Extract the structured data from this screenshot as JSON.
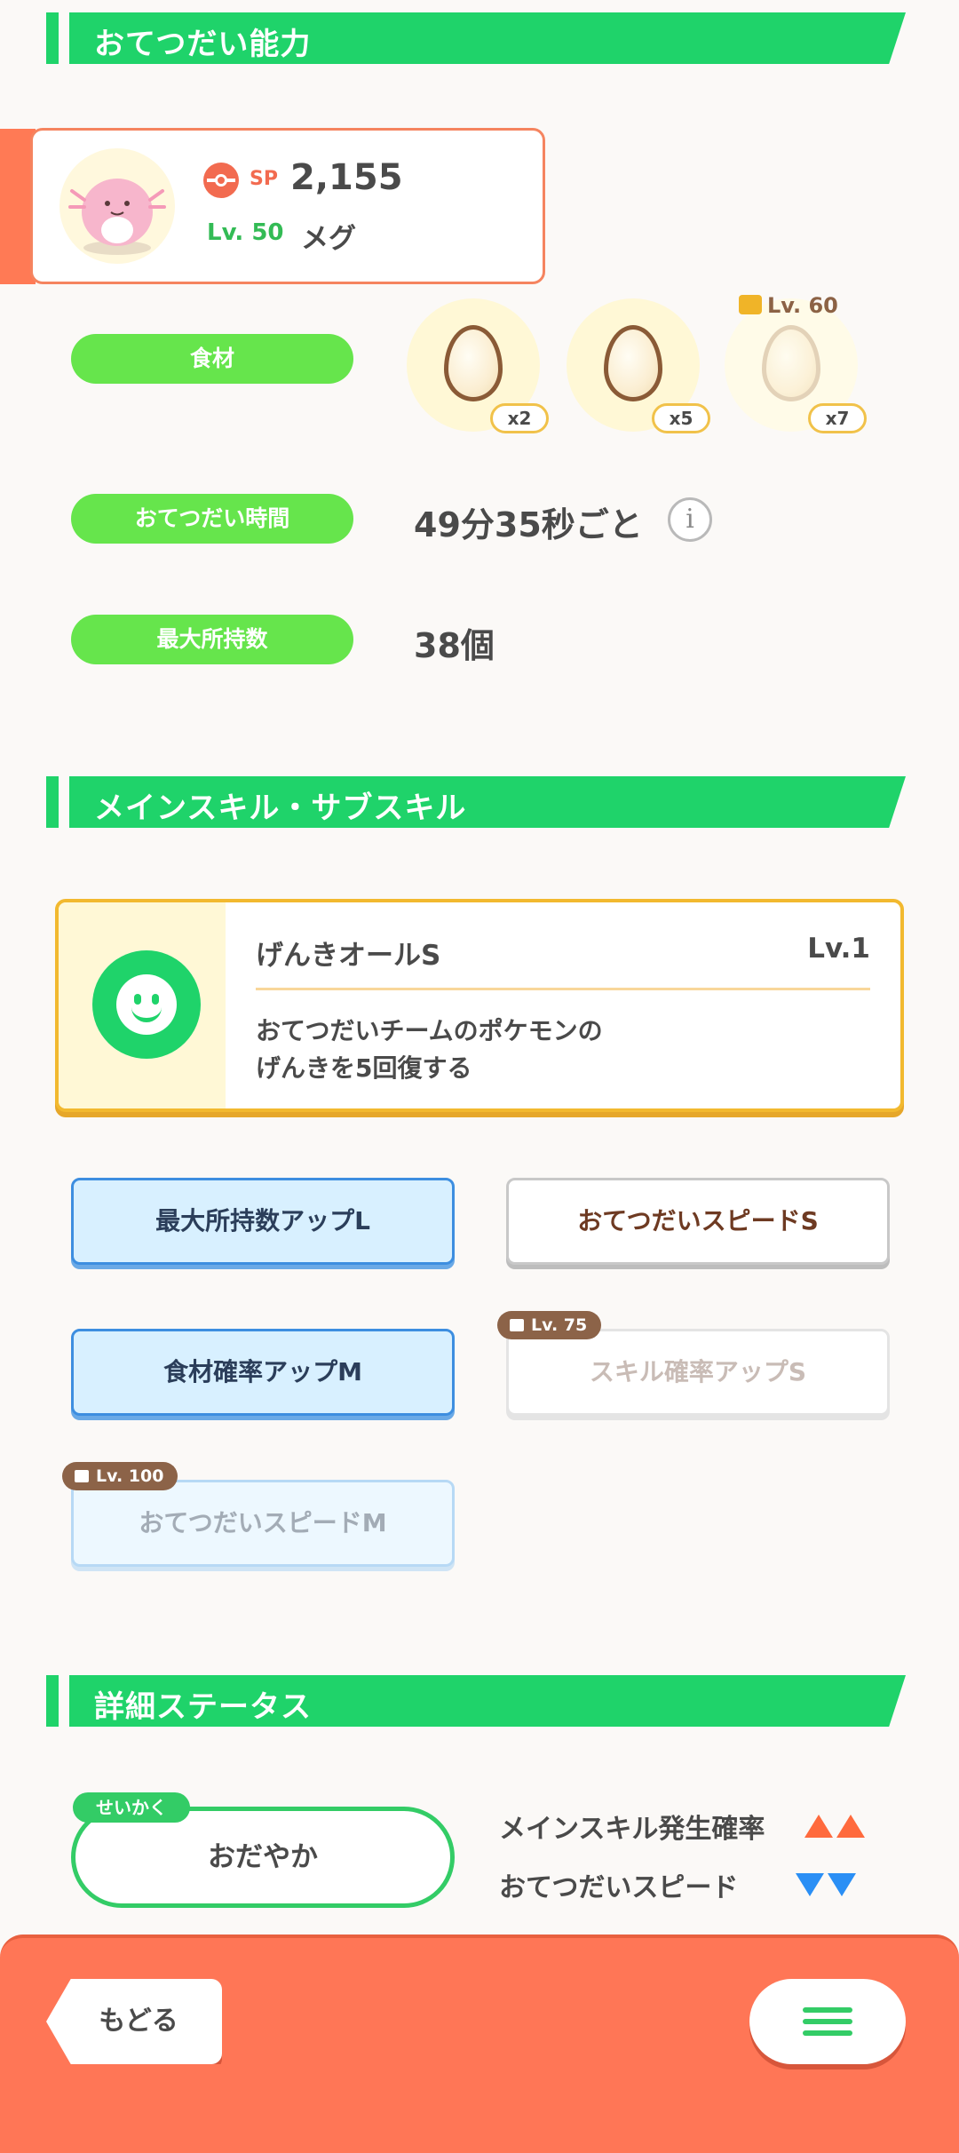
{
  "sections": {
    "helping": "おてつだい能力",
    "skills": "メインスキル・サブスキル",
    "details": "詳細ステータス"
  },
  "pokemon": {
    "sp_label": "SP",
    "sp_value": "2,155",
    "level": "Lv. 50",
    "name": "メグ"
  },
  "ingredients": {
    "label": "食材",
    "items": [
      {
        "icon": "egg-icon",
        "qty": "x2"
      },
      {
        "icon": "egg-icon",
        "qty": "x5"
      },
      {
        "icon": "egg-icon",
        "qty": "x7",
        "unlock": "Lv. 60"
      }
    ]
  },
  "help_time": {
    "label": "おてつだい時間",
    "value": "49分35秒ごと"
  },
  "max_carry": {
    "label": "最大所持数",
    "value": "38個"
  },
  "main_skill": {
    "name": "げんきオールS",
    "level": "Lv.1",
    "description": "おてつだいチームのポケモンの\nげんきを5回復する"
  },
  "sub_skills": [
    {
      "label": "最大所持数アップL",
      "style": "blue",
      "locked": false
    },
    {
      "label": "おてつだいスピードS",
      "style": "white",
      "locked": false
    },
    {
      "label": "食材確率アップM",
      "style": "blue",
      "locked": false
    },
    {
      "label": "スキル確率アップS",
      "style": "white",
      "locked": true,
      "unlock": "Lv. 75"
    },
    {
      "label": "おてつだいスピードM",
      "style": "blue",
      "locked": true,
      "unlock": "Lv. 100"
    }
  ],
  "nature": {
    "tag": "せいかく",
    "value": "おだやか",
    "effects": [
      {
        "label": "メインスキル発生確率",
        "direction": "up"
      },
      {
        "label": "おてつだいスピード",
        "direction": "down"
      }
    ]
  },
  "nav": {
    "back": "もどる",
    "menu_icon": "hamburger-menu-icon"
  },
  "colors": {
    "accent_green": "#1fd36a",
    "bottom_bar": "#ff7656",
    "up": "#ff6a3d",
    "down": "#2a8ff5"
  }
}
